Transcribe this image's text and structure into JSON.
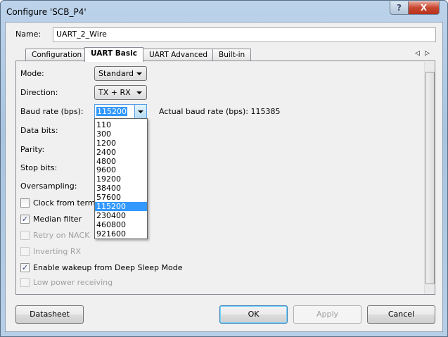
{
  "window": {
    "title": "Configure 'SCB_P4'",
    "help": "?",
    "close": "X"
  },
  "name": {
    "label": "Name:",
    "value": "UART_2_Wire"
  },
  "tabs": [
    "Configuration",
    "UART Basic",
    "UART Advanced",
    "Built-in"
  ],
  "tab_scroll": {
    "left": "◁",
    "right": "▷"
  },
  "fields": {
    "mode": {
      "label": "Mode:",
      "value": "Standard"
    },
    "direction": {
      "label": "Direction:",
      "value": "TX + RX"
    },
    "baud": {
      "label": "Baud rate (bps):",
      "value": "115200",
      "actual": "Actual baud rate (bps): 115385"
    },
    "data_bits": {
      "label": "Data bits:"
    },
    "parity": {
      "label": "Parity:"
    },
    "stop_bits": {
      "label": "Stop bits:"
    },
    "oversampling": {
      "label": "Oversampling:"
    }
  },
  "baud_options": [
    "110",
    "300",
    "1200",
    "2400",
    "4800",
    "9600",
    "19200",
    "38400",
    "57600",
    "115200",
    "230400",
    "460800",
    "921600"
  ],
  "checkboxes": [
    {
      "label": "Clock from terminal",
      "checked": false,
      "enabled": true
    },
    {
      "label": "Median filter",
      "checked": true,
      "enabled": true
    },
    {
      "label": "Retry on NACK",
      "checked": false,
      "enabled": false
    },
    {
      "label": "Inverting RX",
      "checked": false,
      "enabled": false
    },
    {
      "label": "Enable wakeup from Deep Sleep Mode",
      "checked": true,
      "enabled": true
    },
    {
      "label": "Low power receiving",
      "checked": false,
      "enabled": false
    }
  ],
  "buttons": {
    "datasheet": "Datasheet",
    "ok": "OK",
    "apply": "Apply",
    "cancel": "Cancel"
  }
}
